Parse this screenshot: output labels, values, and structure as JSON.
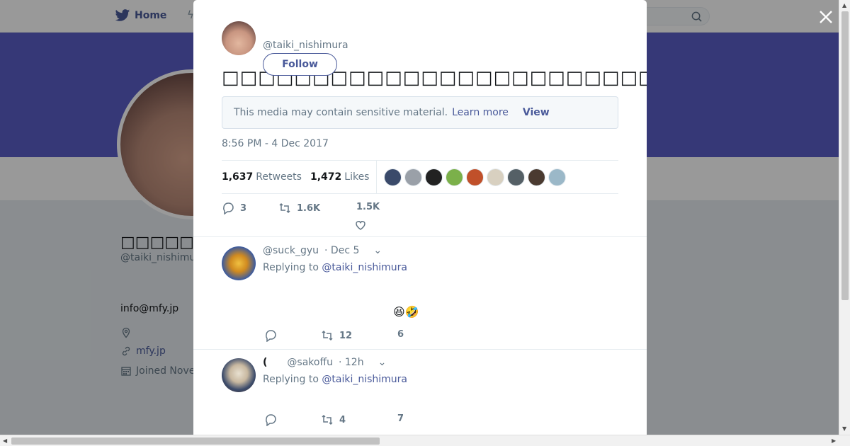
{
  "nav": {
    "home_label": "Home"
  },
  "profile": {
    "display_name": "□□□□□",
    "handle": "@taiki_nishimu",
    "email": "info@mfy.jp",
    "website": "mfy.jp",
    "joined": "Joined Nove"
  },
  "tweet": {
    "author_handle": "@taiki_nishimura",
    "follow_label": "Follow",
    "text": "□□□□□□□□□□□□□□□□□□□□□□□□□□□□□□□□□□□□□□□□□□□□□□□□",
    "sensitive_notice": "This media may contain sensitive material.",
    "learn_more": "Learn more",
    "view_label": "View",
    "timestamp": "8:56 PM - 4 Dec 2017",
    "retweets_count": "1,637",
    "retweets_label": "Retweets",
    "likes_count": "1,472",
    "likes_label": "Likes",
    "actions": {
      "replies": "3",
      "retweets": "1.6K",
      "likes": "1.5K"
    }
  },
  "likers": [
    "#3a4a6a",
    "#9aa0a8",
    "#222222",
    "#7bb04a",
    "#c0502a",
    "#d8d0c0",
    "#556066",
    "#4a3a30",
    "#9bb8c8"
  ],
  "replies": [
    {
      "handle": "@suck_gyu",
      "time": "· Dec 5",
      "replying_prefix": "Replying to",
      "replying_to": "@taiki_nishimura",
      "body": "😆🤣",
      "retweets": "12",
      "likes": "6"
    },
    {
      "name": "(",
      "handle": "@sakoffu",
      "time": "· 12h",
      "replying_prefix": "Replying to",
      "replying_to": "@taiki_nishimura",
      "body": "",
      "retweets": "4",
      "likes": "7"
    }
  ],
  "colors": {
    "accent": "#4a5a9a",
    "banner": "#5b5ec6",
    "muted": "#657786"
  }
}
